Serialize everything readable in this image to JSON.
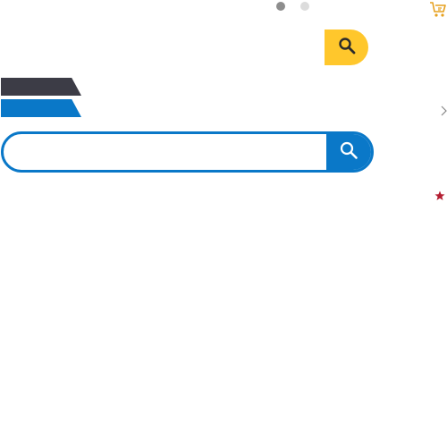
{
  "carousel": {
    "dots": [
      {
        "active": true
      },
      {
        "active": false
      }
    ]
  },
  "icons": {
    "cart": "shopping-cart-icon",
    "search": "search-icon",
    "chevron": "chevron-right-icon",
    "star": "star-icon"
  },
  "search": {
    "value": "",
    "placeholder": ""
  },
  "colors": {
    "accent_yellow": "#ffc72c",
    "brand_blue": "#0a78c8",
    "brand_dark": "#3c3c46",
    "star_red": "#b41e32",
    "cart_orange": "#e6a01e"
  }
}
